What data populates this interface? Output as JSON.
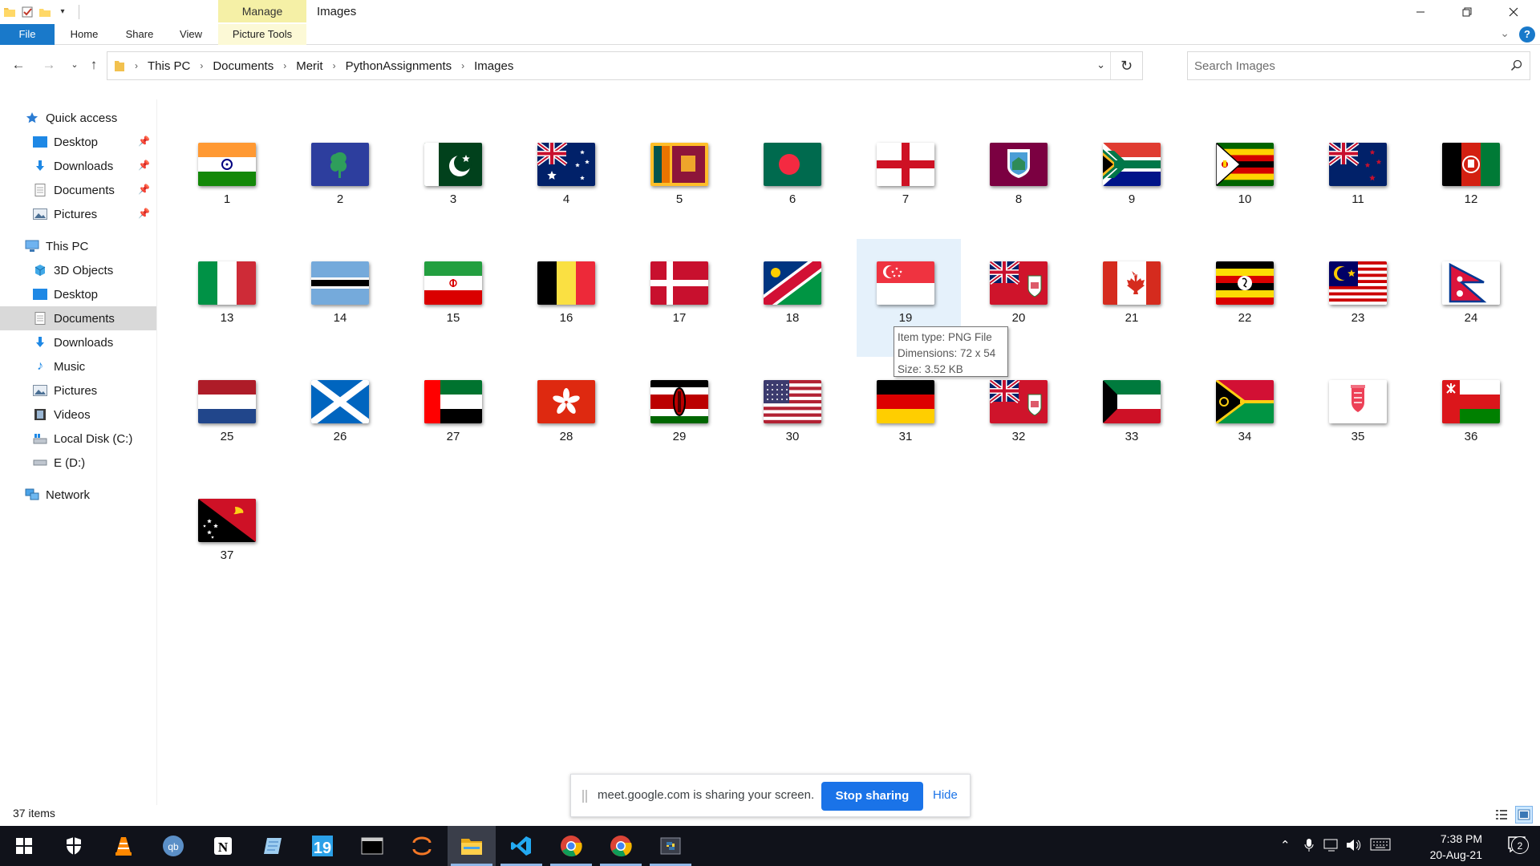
{
  "window": {
    "title": "Images",
    "contextual_tab": "Manage"
  },
  "ribbon": {
    "tabs": [
      "File",
      "Home",
      "Share",
      "View",
      "Picture Tools"
    ]
  },
  "address": {
    "crumbs": [
      "This PC",
      "Documents",
      "Merit",
      "PythonAssignments",
      "Images"
    ]
  },
  "search": {
    "placeholder": "Search Images"
  },
  "sidebar": {
    "quick_access": "Quick access",
    "quick_items": [
      "Desktop",
      "Downloads",
      "Documents",
      "Pictures"
    ],
    "this_pc": "This PC",
    "pc_items": [
      "3D Objects",
      "Desktop",
      "Documents",
      "Downloads",
      "Music",
      "Pictures",
      "Videos",
      "Local Disk (C:)",
      "E (D:)"
    ],
    "network": "Network",
    "selected": "Documents"
  },
  "files": [
    {
      "name": "1",
      "flag": "india"
    },
    {
      "name": "2",
      "flag": "ireland-cricket"
    },
    {
      "name": "3",
      "flag": "pakistan"
    },
    {
      "name": "4",
      "flag": "australia"
    },
    {
      "name": "5",
      "flag": "sri-lanka"
    },
    {
      "name": "6",
      "flag": "bangladesh"
    },
    {
      "name": "7",
      "flag": "england"
    },
    {
      "name": "8",
      "flag": "west-indies"
    },
    {
      "name": "9",
      "flag": "south-africa"
    },
    {
      "name": "10",
      "flag": "zimbabwe"
    },
    {
      "name": "11",
      "flag": "new-zealand"
    },
    {
      "name": "12",
      "flag": "afghanistan"
    },
    {
      "name": "13",
      "flag": "italy"
    },
    {
      "name": "14",
      "flag": "botswana"
    },
    {
      "name": "15",
      "flag": "iran"
    },
    {
      "name": "16",
      "flag": "belgium"
    },
    {
      "name": "17",
      "flag": "denmark"
    },
    {
      "name": "18",
      "flag": "namibia"
    },
    {
      "name": "19",
      "flag": "singapore"
    },
    {
      "name": "20",
      "flag": "bermuda"
    },
    {
      "name": "21",
      "flag": "canada"
    },
    {
      "name": "22",
      "flag": "uganda"
    },
    {
      "name": "23",
      "flag": "malaysia"
    },
    {
      "name": "24",
      "flag": "nepal"
    },
    {
      "name": "25",
      "flag": "netherlands"
    },
    {
      "name": "26",
      "flag": "scotland"
    },
    {
      "name": "27",
      "flag": "uae"
    },
    {
      "name": "28",
      "flag": "hong-kong"
    },
    {
      "name": "29",
      "flag": "kenya"
    },
    {
      "name": "30",
      "flag": "usa"
    },
    {
      "name": "31",
      "flag": "germany"
    },
    {
      "name": "32",
      "flag": "bermuda"
    },
    {
      "name": "33",
      "flag": "kuwait"
    },
    {
      "name": "34",
      "flag": "vanuatu"
    },
    {
      "name": "35",
      "flag": "jersey"
    },
    {
      "name": "36",
      "flag": "oman"
    },
    {
      "name": "37",
      "flag": "papua-new-guinea"
    }
  ],
  "hover_item": "19",
  "tooltip": {
    "type": "Item type: PNG File",
    "dimensions": "Dimensions: 72 x 54",
    "size": "Size: 3.52 KB"
  },
  "status": {
    "count": "37 items"
  },
  "share_bar": {
    "message": "meet.google.com is sharing your screen.",
    "stop": "Stop sharing",
    "hide": "Hide"
  },
  "taskbar": {
    "apps": [
      "start-icon",
      "security-icon",
      "vlc-icon",
      "qbittorrent-icon",
      "notion-icon",
      "notepad-icon",
      "calendar-icon",
      "terminal-icon",
      "jupyter-icon",
      "file-explorer-icon",
      "vscode-icon",
      "chrome-icon",
      "chrome-icon",
      "python-icon"
    ],
    "calendar_day": "19",
    "time": "7:38 PM",
    "date": "20-Aug-21",
    "notifications": "2"
  },
  "colors": {
    "file_tab": "#1979ca",
    "manage_tab": "#f5f0a6",
    "hover": "#e5f1fb",
    "selected_nav": "#d9d9d9",
    "stop_button": "#1a73e8",
    "taskbar": "#10121a"
  }
}
